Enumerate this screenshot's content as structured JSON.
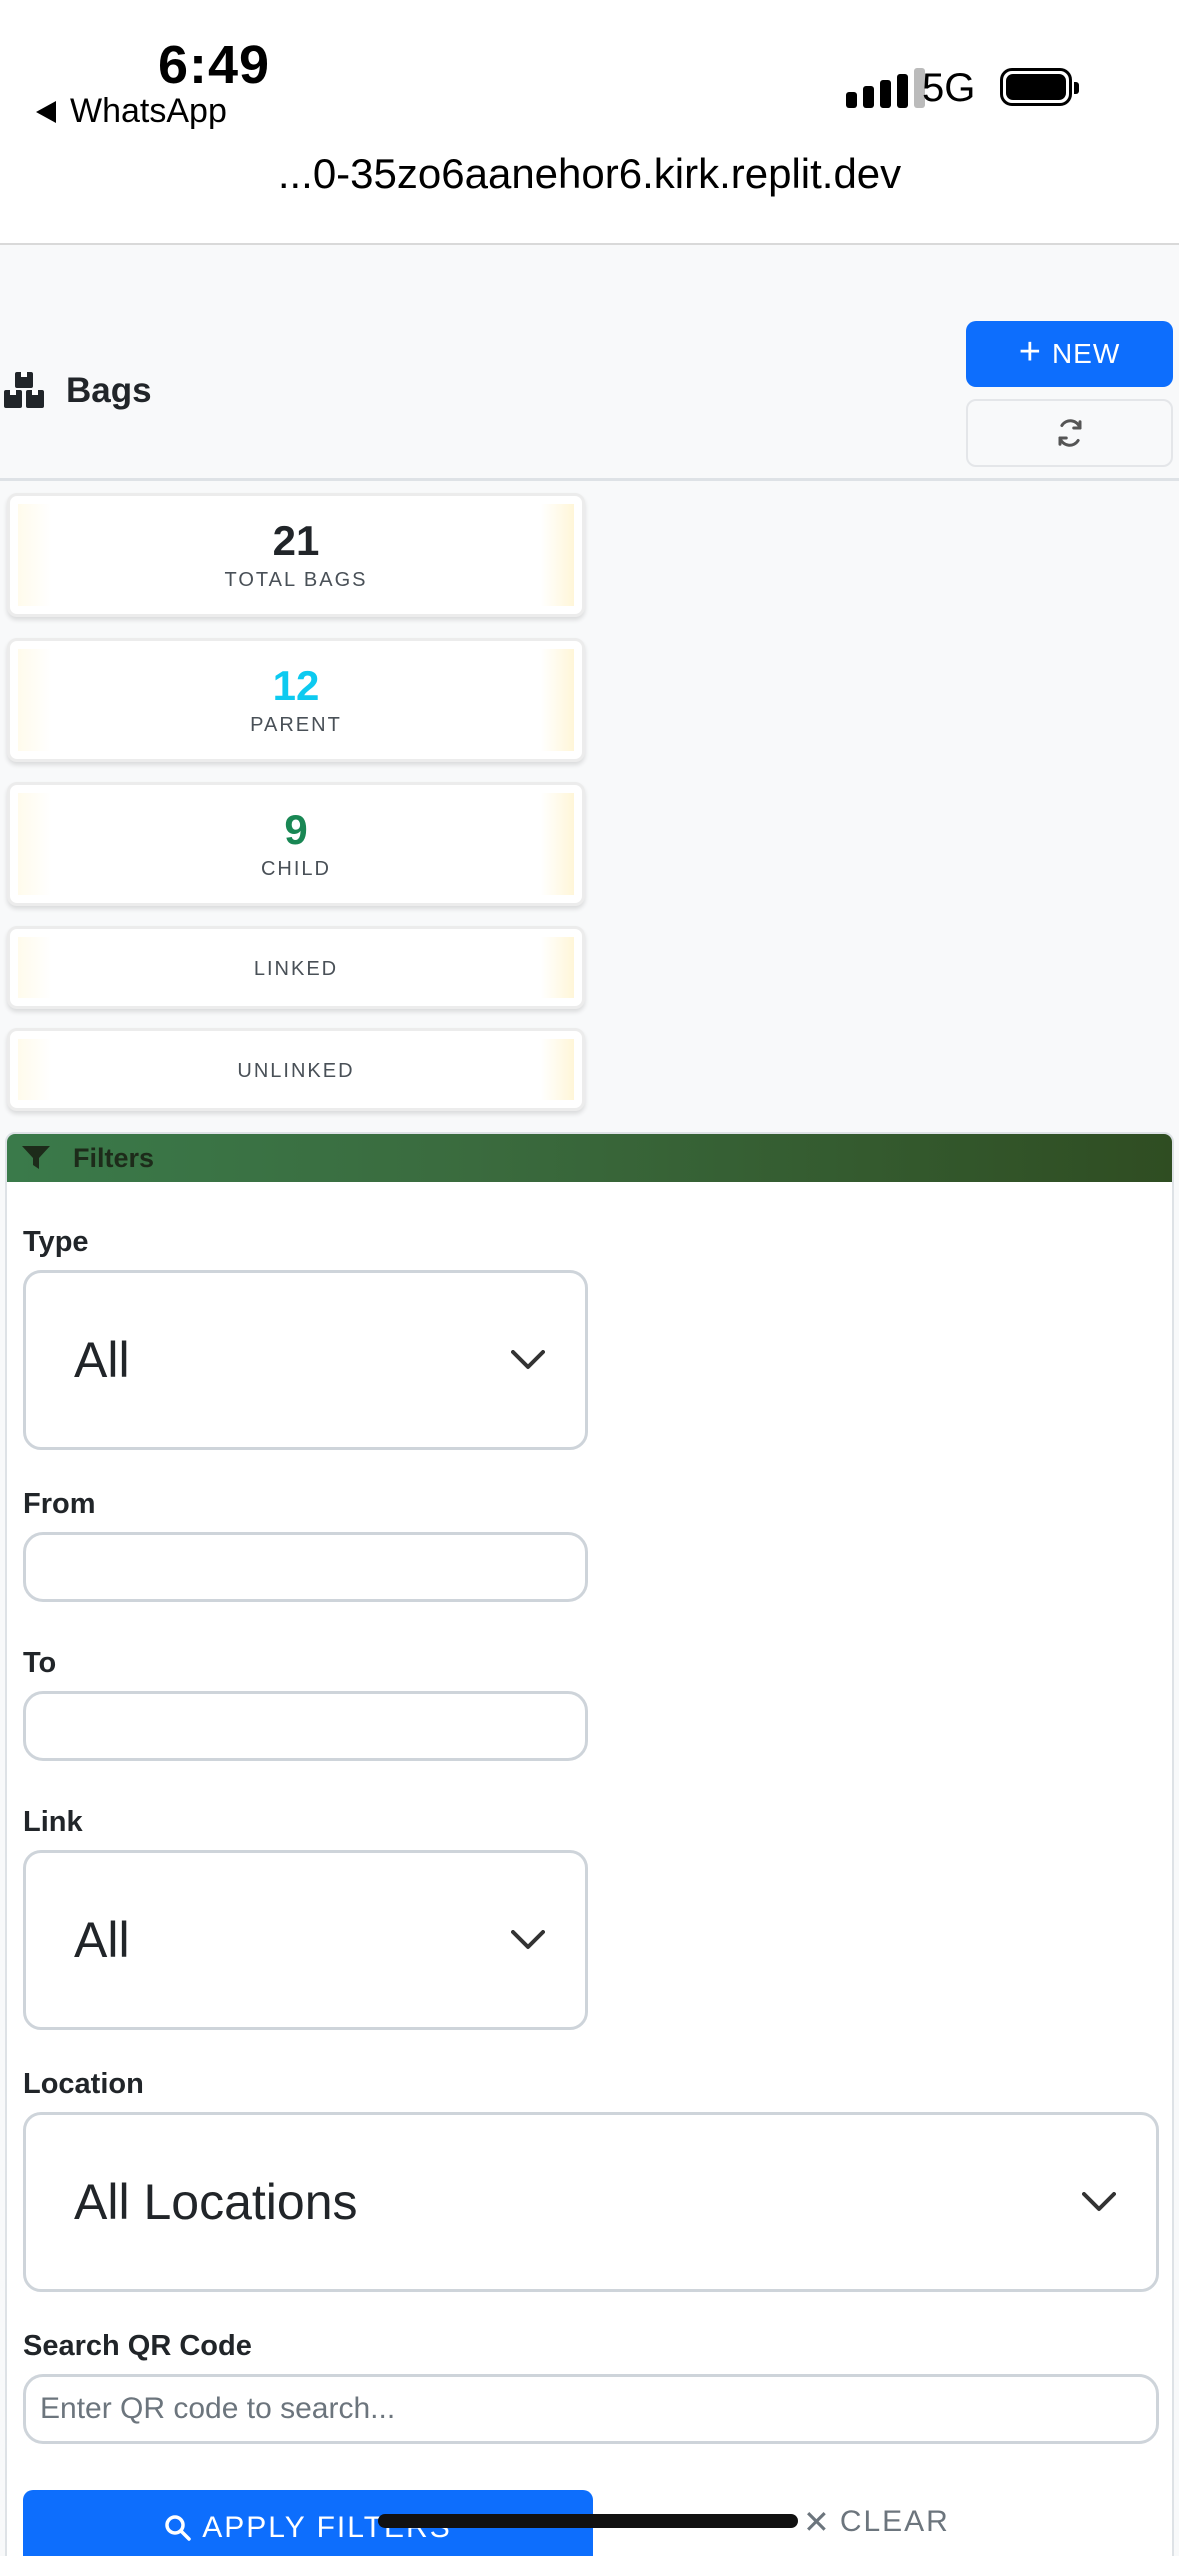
{
  "status_bar": {
    "time": "6:49",
    "back_app": "WhatsApp",
    "network": "5G"
  },
  "browser": {
    "url": "...0-35zo6aanehor6.kirk.replit.dev"
  },
  "header": {
    "title": "Bags",
    "icon": "boxes-icon",
    "new_button": "NEW",
    "refresh_icon": "refresh-icon"
  },
  "stats": [
    {
      "value": "21",
      "label": "TOTAL BAGS",
      "color": "#212529"
    },
    {
      "value": "12",
      "label": "PARENT",
      "color": "#0dcaf0"
    },
    {
      "value": "9",
      "label": "CHILD",
      "color": "#198754"
    },
    {
      "value": "",
      "label": "LINKED",
      "color": "#212529"
    },
    {
      "value": "",
      "label": "UNLINKED",
      "color": "#212529"
    }
  ],
  "filters": {
    "title": "Filters",
    "type": {
      "label": "Type",
      "value": "All"
    },
    "from": {
      "label": "From",
      "value": ""
    },
    "to": {
      "label": "To",
      "value": ""
    },
    "link": {
      "label": "Link",
      "value": "All"
    },
    "location": {
      "label": "Location",
      "value": "All Locations"
    },
    "search": {
      "label": "Search QR Code",
      "placeholder": "Enter QR code to search..."
    },
    "apply_button": "APPLY FILTERS",
    "clear_button": "CLEAR"
  },
  "colors": {
    "primary": "#0d6efd",
    "filters_header_start": "#3a7a4a",
    "filters_header_end": "#2f4d22"
  }
}
